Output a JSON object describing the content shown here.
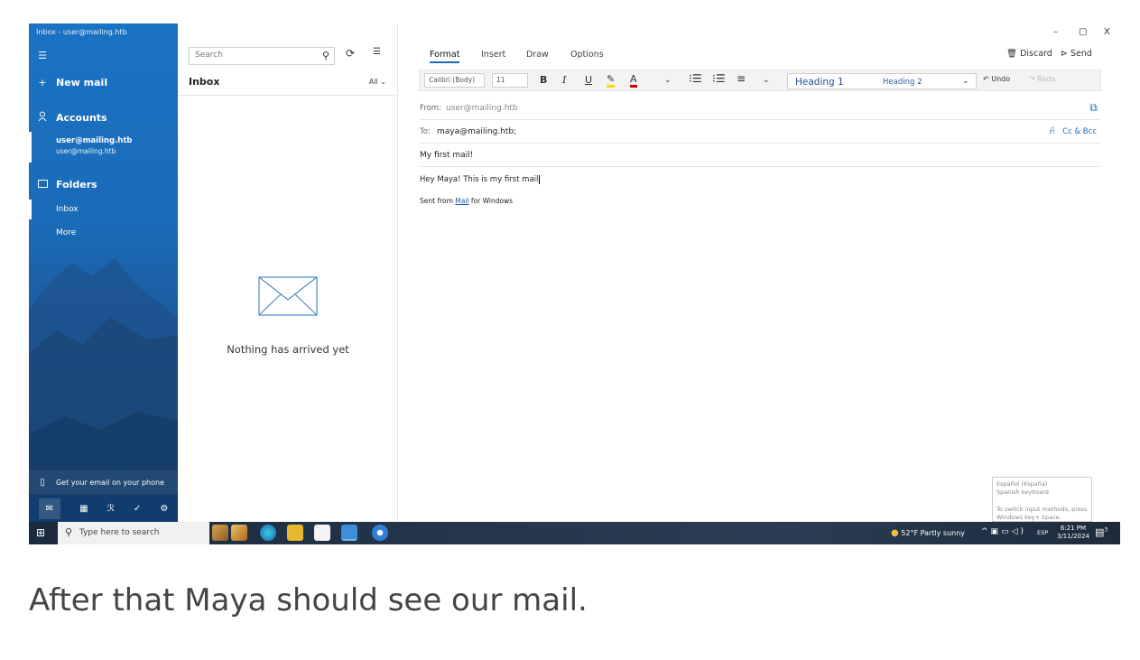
{
  "window": {
    "title": "Inbox - user@mailing.htb",
    "minimize": "–",
    "maximize": "▢",
    "close": "X"
  },
  "sidebar": {
    "new_mail": "New mail",
    "accounts": "Accounts",
    "account_name": "user@mailing.htb",
    "account_email": "user@mailing.htb",
    "folders": "Folders",
    "folder_inbox": "Inbox",
    "folder_more": "More",
    "phone_promo": "Get your email on your phone"
  },
  "list": {
    "search_placeholder": "Search",
    "heading": "Inbox",
    "filter": "All",
    "empty_message": "Nothing has arrived yet"
  },
  "compose": {
    "tabs": [
      "Format",
      "Insert",
      "Draw",
      "Options"
    ],
    "discard": "Discard",
    "send": "Send",
    "font_name": "Calibri (Body)",
    "font_size": "11",
    "bold": "B",
    "italic": "I",
    "underline": "U",
    "font_color": "A",
    "heading1": "Heading 1",
    "heading2": "Heading 2",
    "undo": "Undo",
    "redo": "Redo",
    "from_label": "From:",
    "from_value": "user@mailing.htb",
    "to_label": "To:",
    "to_value": "maya@mailing.htb;",
    "cc_bcc": "Cc & Bcc",
    "subject": "My first mail!",
    "body_text": "Hey Maya! This is my first mail",
    "signature_prefix": "Sent from ",
    "signature_link": "Mail",
    "signature_suffix": " for Windows",
    "ime_line1": "Español (España)",
    "ime_line2": "Spanish keyboard",
    "ime_line3": "To switch input methods, press",
    "ime_line4": "Windows key+ Space."
  },
  "taskbar": {
    "search_placeholder": "Type here to search",
    "weather": "52°F  Partly sunny",
    "language": "ESP",
    "time": "6:21 PM",
    "date": "3/11/2024",
    "notification_count": "3"
  },
  "caption": "After that Maya should see our mail.",
  "colors": {
    "accent": "#1a6bb8",
    "taskbar": "#24364a"
  }
}
